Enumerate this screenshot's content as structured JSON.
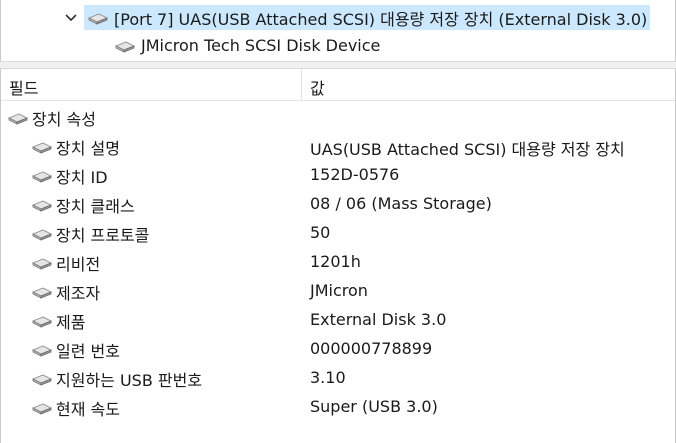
{
  "tree": {
    "port_node_label": "[Port 7] UAS(USB Attached SCSI) 대용량 저장 장치 (External Disk 3.0)",
    "child_node_label": "JMicron Tech SCSI Disk Device"
  },
  "properties": {
    "columns": {
      "field": "필드",
      "value": "값"
    },
    "group_label": "장치 속성",
    "rows": [
      {
        "field": "장치 설명",
        "value": "UAS(USB Attached SCSI) 대용량 저장 장치"
      },
      {
        "field": "장치 ID",
        "value": "152D-0576"
      },
      {
        "field": "장치 클래스",
        "value": "08 / 06 (Mass Storage)"
      },
      {
        "field": "장치 프로토콜",
        "value": "50"
      },
      {
        "field": "리비전",
        "value": "1201h"
      },
      {
        "field": "제조자",
        "value": "JMicron"
      },
      {
        "field": "제품",
        "value": "External Disk 3.0"
      },
      {
        "field": "일련 번호",
        "value": "000000778899"
      },
      {
        "field": "지원하는 USB 판번호",
        "value": "3.10"
      },
      {
        "field": "현재 속도",
        "value": "Super  (USB 3.0)"
      }
    ]
  },
  "colors": {
    "selection": "#cce8ff",
    "text": "#1a1a1a",
    "grid": "#e5e5e5"
  },
  "icons": {
    "expand": "chevron-down-icon",
    "device": "disk-drive-icon"
  }
}
